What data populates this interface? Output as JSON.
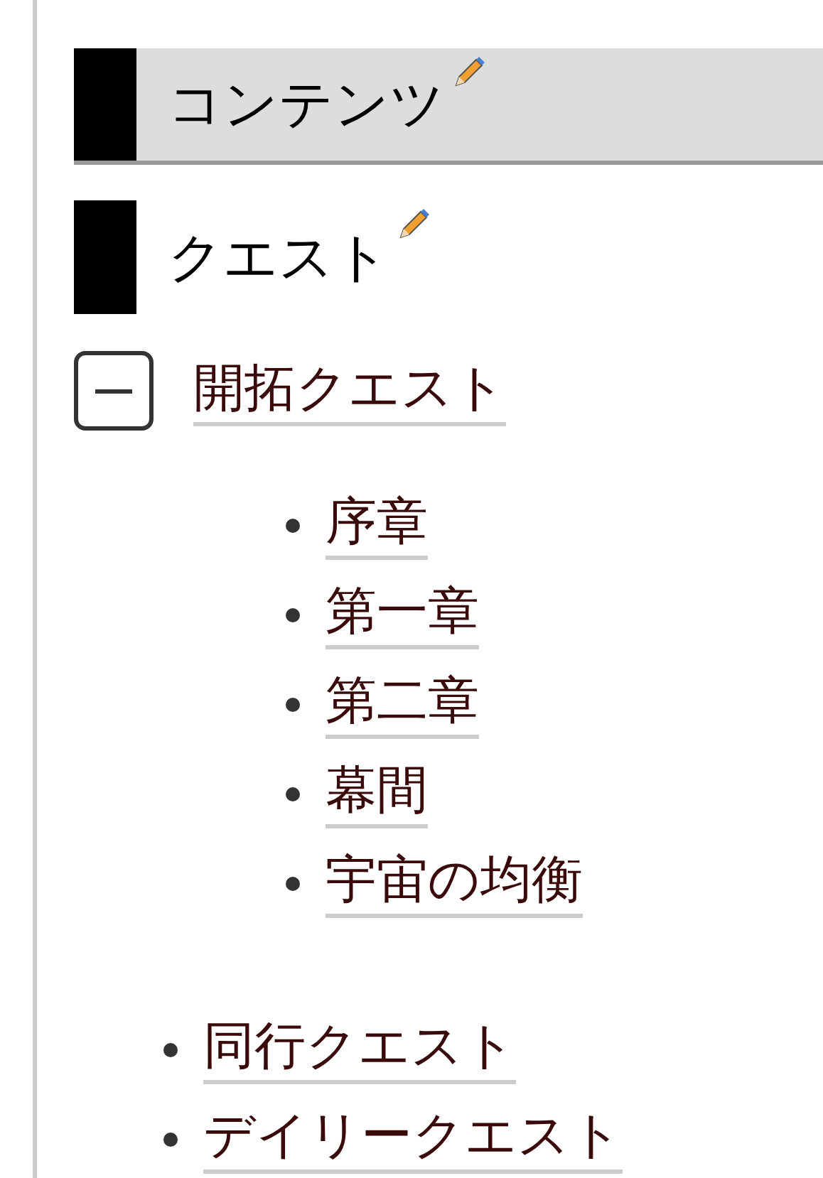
{
  "headings": [
    {
      "title": "コンテンツ",
      "kind": "main"
    },
    {
      "title": "クエスト",
      "kind": "sub"
    }
  ],
  "groups": [
    {
      "label": "開拓クエスト",
      "expanded": true,
      "children": [
        {
          "label": "序章"
        },
        {
          "label": "第一章"
        },
        {
          "label": "第二章"
        },
        {
          "label": "幕間"
        },
        {
          "label": "宇宙の均衡"
        }
      ]
    }
  ],
  "links": [
    {
      "label": "同行クエスト"
    },
    {
      "label": "デイリークエスト"
    }
  ]
}
